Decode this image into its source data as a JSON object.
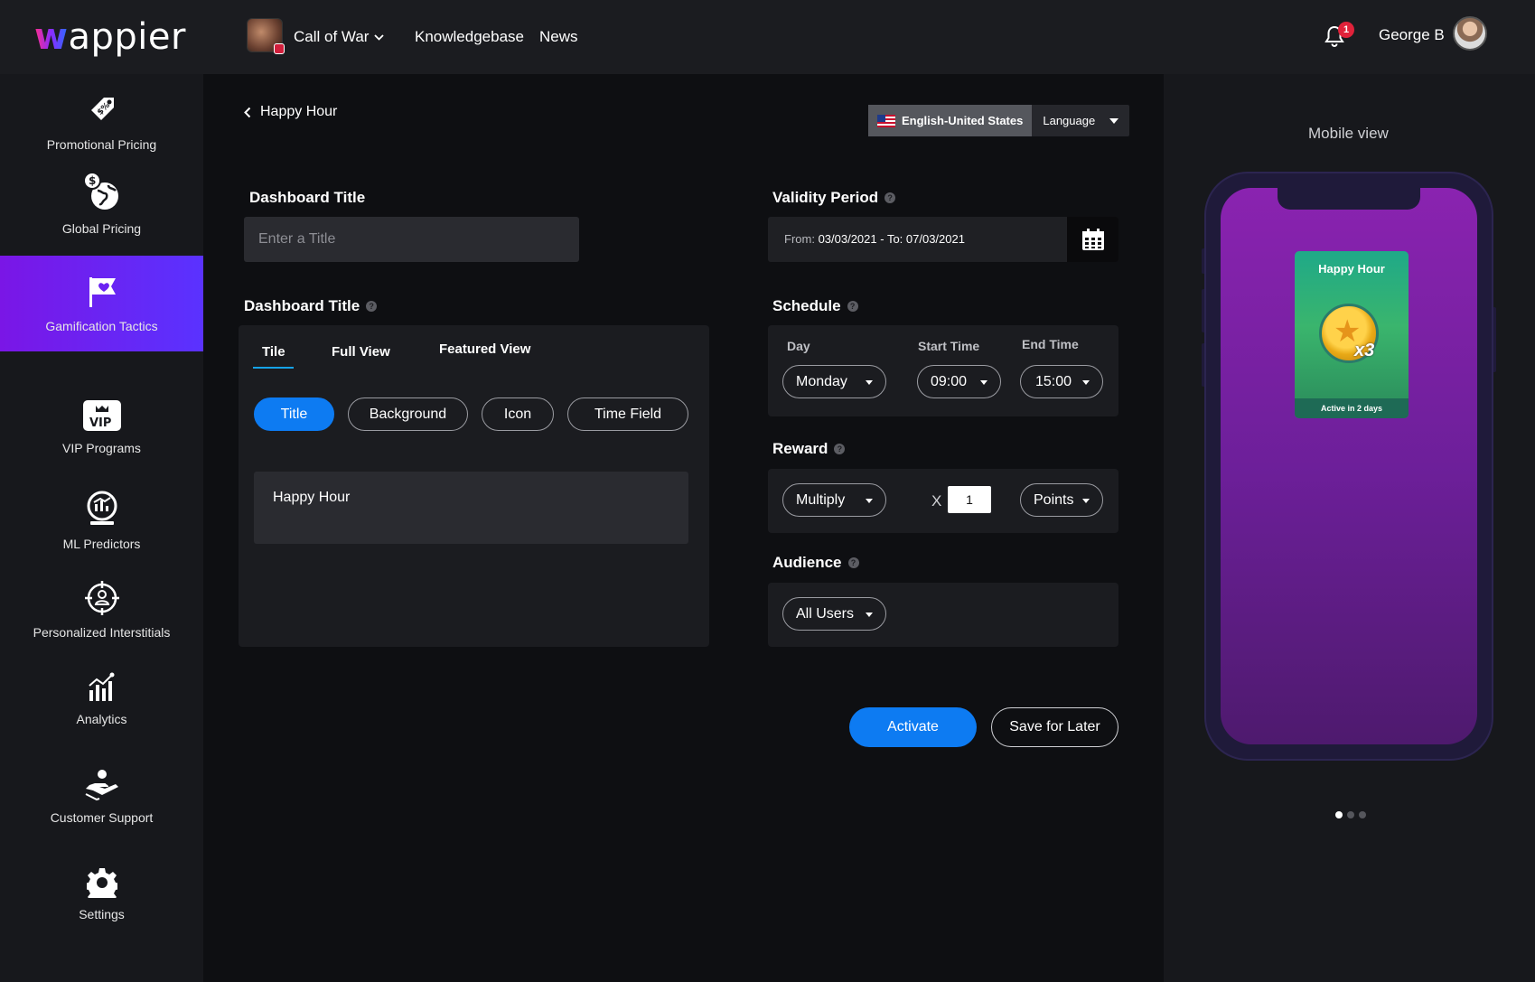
{
  "header": {
    "logo_w": "w",
    "logo_rest": "appier",
    "game_name": "Call of War",
    "nav": [
      "Knowledgebase",
      "News"
    ],
    "notification_count": "1",
    "user_name": "George B"
  },
  "sidebar": {
    "items": [
      {
        "label": "Promotional Pricing",
        "icon": "price-tag-icon"
      },
      {
        "label": "Global Pricing",
        "icon": "globe-dollar-icon"
      },
      {
        "label": "Gamification Tactics",
        "icon": "flag-heart-icon",
        "active": true
      },
      {
        "label": "VIP Programs",
        "icon": "vip-crown-icon"
      },
      {
        "label": "ML Predictors",
        "icon": "crystal-ball-chart-icon"
      },
      {
        "label": "Personalized Interstitials",
        "icon": "target-user-icon"
      },
      {
        "label": "Analytics",
        "icon": "bar-chart-icon"
      },
      {
        "label": "Customer Support",
        "icon": "hand-person-icon"
      },
      {
        "label": "Settings",
        "icon": "gear-icon"
      }
    ]
  },
  "page": {
    "back_label": "Happy Hour",
    "language": {
      "selected": "English-United States",
      "dropdown_label": "Language"
    }
  },
  "form": {
    "dashboard_title_label": "Dashboard Title",
    "dashboard_title_placeholder": "Enter a Title",
    "editor_label": "Dashboard Title",
    "tabs": [
      "Tile",
      "Full View",
      "Featured View"
    ],
    "pills": [
      "Title",
      "Background",
      "Icon",
      "Time Field"
    ],
    "active_pill": "Title",
    "text_value": "Happy Hour",
    "validity": {
      "label": "Validity Period",
      "from_prefix": "From: ",
      "range": "03/03/2021 - To: 07/03/2021"
    },
    "schedule": {
      "label": "Schedule",
      "day_label": "Day",
      "start_label": "Start Time",
      "end_label": "End Time",
      "day": "Monday",
      "start": "09:00",
      "end": "15:00"
    },
    "reward": {
      "label": "Reward",
      "operation": "Multiply",
      "x": "X",
      "multiplier": "1",
      "unit": "Points"
    },
    "audience": {
      "label": "Audience",
      "value": "All Users"
    },
    "help": "?",
    "activate": "Activate",
    "save_later": "Save for Later"
  },
  "preview": {
    "label": "Mobile view",
    "card_title": "Happy Hour",
    "card_badge": "x3",
    "card_footer": "Active in 2 days",
    "page_dots": 3,
    "active_dot": 1
  },
  "colors": {
    "accent_blue": "#0d7bf2",
    "active_gradient": "#7a16e6",
    "phone_screen": "#8a23b0",
    "card_green": "#1fa988",
    "notification": "#e0223a"
  }
}
